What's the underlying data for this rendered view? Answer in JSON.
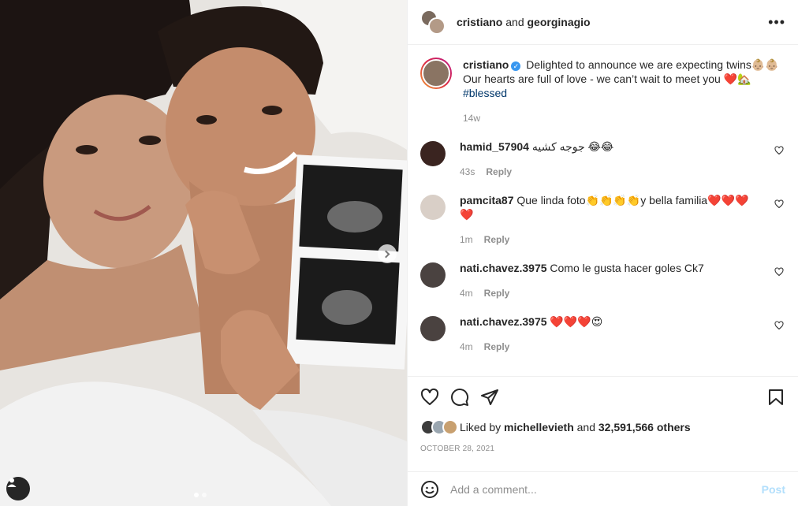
{
  "header": {
    "user1": "cristiano",
    "conjunction": "and",
    "user2": "georginagio",
    "more": "•••"
  },
  "caption": {
    "username": "cristiano",
    "text": "Delighted to announce we are expecting twins👶🏼👶🏼 Our hearts are full of love - we can’t wait to meet you ❤️🏡",
    "hashtag": "#blessed",
    "time": "14w"
  },
  "comments": [
    {
      "username": "hamid_57904",
      "text": "جوجه کشیه 😂😂",
      "time": "43s",
      "reply": "Reply",
      "avatar_color": "#3a2420"
    },
    {
      "username": "pamcita87",
      "text": "Que linda foto👏👏👏👏y bella familia❤️❤️❤️❤️",
      "time": "1m",
      "reply": "Reply",
      "avatar_color": "#d9cfc7"
    },
    {
      "username": "nati.chavez.3975",
      "text": "Como le gusta hacer goles Ck7",
      "time": "4m",
      "reply": "Reply",
      "avatar_color": "#4a4240"
    },
    {
      "username": "nati.chavez.3975",
      "text": "❤️❤️❤️😍",
      "time": "4m",
      "reply": "Reply",
      "avatar_color": "#4a4240"
    }
  ],
  "likes": {
    "prefix": "Liked by",
    "user": "michellevieth",
    "conjunction": "and",
    "others": "32,591,566 others"
  },
  "date": "OCTOBER 28, 2021",
  "add_comment": {
    "placeholder": "Add a comment...",
    "post_label": "Post"
  },
  "colors": {
    "link": "#00376b",
    "verified": "#3897f0",
    "post_disabled": "#b2dffc",
    "muted": "#8e8e8e"
  }
}
